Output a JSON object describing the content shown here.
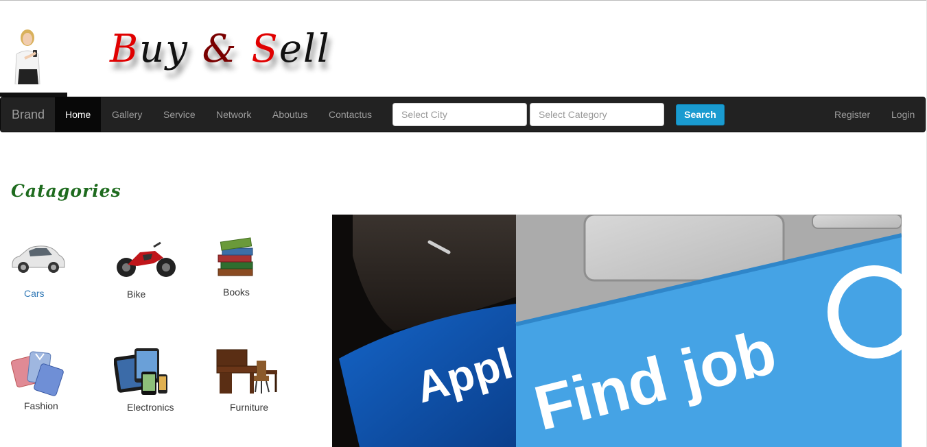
{
  "header": {
    "logo": {
      "part1_initial": "B",
      "part1_rest": "uy",
      "amp": "&",
      "part2_initial": "S",
      "part2_rest": "ell"
    }
  },
  "navbar": {
    "brand": "Brand",
    "items": [
      {
        "label": "Home",
        "active": true
      },
      {
        "label": "Gallery"
      },
      {
        "label": "Service"
      },
      {
        "label": "Network"
      },
      {
        "label": "Aboutus"
      },
      {
        "label": "Contactus"
      }
    ],
    "city": {
      "placeholder": "Select City"
    },
    "category": {
      "placeholder": "Select Category"
    },
    "search_label": "Search",
    "register_label": "Register",
    "login_label": "Login"
  },
  "categories": {
    "title": "Catagories",
    "items": [
      {
        "label": "Cars",
        "icon": "car-icon"
      },
      {
        "label": "Bike",
        "icon": "motorbike-icon"
      },
      {
        "label": "Books",
        "icon": "books-icon"
      },
      {
        "label": "Fashion",
        "icon": "shirts-icon"
      },
      {
        "label": "Electronics",
        "icon": "devices-icon"
      },
      {
        "label": "Furniture",
        "icon": "furniture-icon"
      }
    ]
  },
  "banner": {
    "left_key_text": "Appl",
    "right_key_text": "Find job"
  },
  "colors": {
    "navbar_bg": "#222222",
    "search_button": "#1a9bd0",
    "logo_red": "#e00000",
    "categories_title": "#1e6b1e",
    "link": "#337ab7"
  }
}
